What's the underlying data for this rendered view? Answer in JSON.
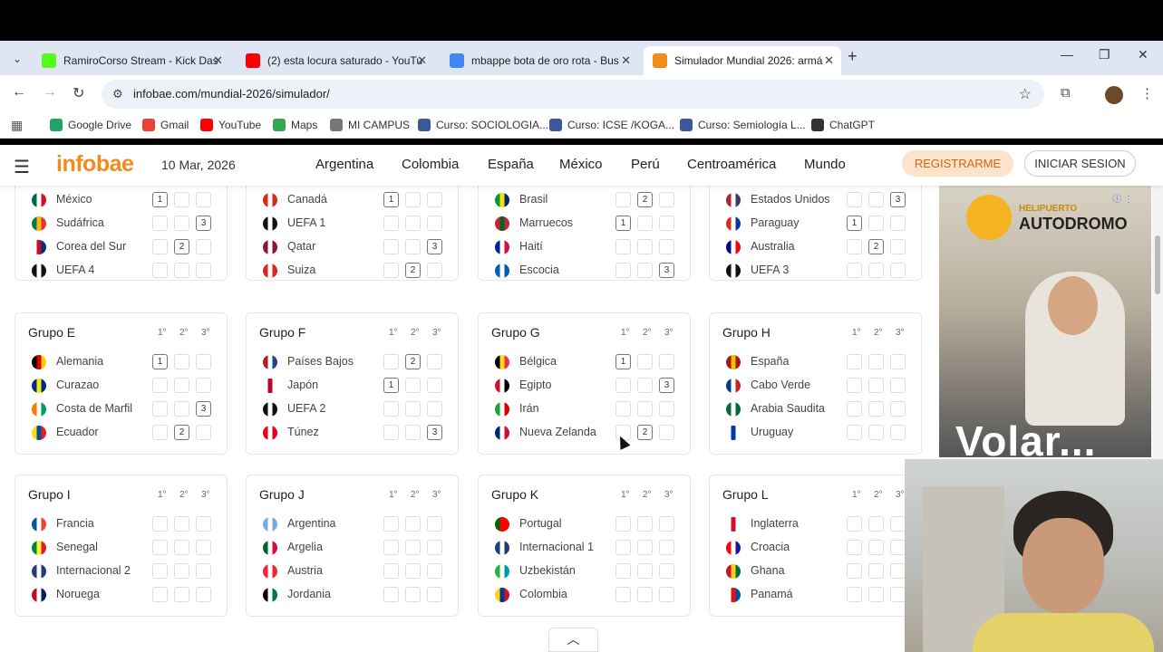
{
  "browser": {
    "tabs": [
      {
        "title": "RamiroCorso Stream - Kick Das",
        "icon": "kick-icon",
        "color": "#53fc18"
      },
      {
        "title": "(2) esta locura saturado - YouTu",
        "icon": "youtube-icon",
        "color": "#ff0000"
      },
      {
        "title": "mbappe bota de oro rota - Bus",
        "icon": "google-icon",
        "color": "#4285f4"
      },
      {
        "title": "Simulador Mundial 2026: armá",
        "icon": "infobae-icon",
        "color": "#f18b1c"
      }
    ],
    "url": "infobae.com/mundial-2026/simulador/",
    "bookmarks": [
      {
        "label": "Google Drive",
        "color": "#1fa463"
      },
      {
        "label": "Gmail",
        "color": "#ea4335"
      },
      {
        "label": "YouTube",
        "color": "#ff0000"
      },
      {
        "label": "Maps",
        "color": "#34a853"
      },
      {
        "label": "MI CAMPUS",
        "color": "#777777"
      },
      {
        "label": "Curso: SOCIOLOGIA...",
        "color": "#3b5998"
      },
      {
        "label": "Curso: ICSE /KOGA...",
        "color": "#3b5998"
      },
      {
        "label": "Curso: Semiología L...",
        "color": "#3b5998"
      },
      {
        "label": "ChatGPT",
        "color": "#333333"
      }
    ]
  },
  "site": {
    "logo": "infobae",
    "date": "10 Mar, 2026",
    "nav": [
      "Argentina",
      "Colombia",
      "España",
      "México",
      "Perú",
      "Centroamérica",
      "Mundo"
    ],
    "register_label": "REGISTRARME",
    "login_label": "INICIAR SESION"
  },
  "pos_headers": [
    "1°",
    "2°",
    "3°"
  ],
  "groups": [
    {
      "title": "",
      "teams": [
        {
          "name": "México",
          "pick": 1,
          "flag": [
            "#006847",
            "#ffffff",
            "#ce1126"
          ]
        },
        {
          "name": "Sudáfrica",
          "pick": 3,
          "flag": [
            "#007a4d",
            "#ffb612",
            "#de3831"
          ]
        },
        {
          "name": "Corea del Sur",
          "pick": 2,
          "flag": [
            "#ffffff",
            "#c60c30",
            "#003478"
          ]
        },
        {
          "name": "UEFA 4",
          "pick": 0,
          "flag": [
            "#111111",
            "#ffffff",
            "#111111"
          ]
        }
      ]
    },
    {
      "title": "",
      "teams": [
        {
          "name": "Canadá",
          "pick": 1,
          "flag": [
            "#d52b1e",
            "#ffffff",
            "#d52b1e"
          ]
        },
        {
          "name": "UEFA 1",
          "pick": 0,
          "flag": [
            "#111111",
            "#ffffff",
            "#111111"
          ]
        },
        {
          "name": "Qatar",
          "pick": 3,
          "flag": [
            "#8a1538",
            "#ffffff",
            "#8a1538"
          ]
        },
        {
          "name": "Suiza",
          "pick": 2,
          "flag": [
            "#da291c",
            "#ffffff",
            "#da291c"
          ]
        }
      ]
    },
    {
      "title": "",
      "teams": [
        {
          "name": "Brasil",
          "pick": 2,
          "flag": [
            "#009c3b",
            "#ffdf00",
            "#002776"
          ]
        },
        {
          "name": "Marruecos",
          "pick": 1,
          "flag": [
            "#c1272d",
            "#006233",
            "#c1272d"
          ]
        },
        {
          "name": "Haití",
          "pick": 0,
          "flag": [
            "#00209f",
            "#ffffff",
            "#d21034"
          ]
        },
        {
          "name": "Escocia",
          "pick": 3,
          "flag": [
            "#005eb8",
            "#ffffff",
            "#005eb8"
          ]
        }
      ]
    },
    {
      "title": "",
      "teams": [
        {
          "name": "Estados Unidos",
          "pick": 3,
          "flag": [
            "#b22234",
            "#ffffff",
            "#3c3b6e"
          ]
        },
        {
          "name": "Paraguay",
          "pick": 1,
          "flag": [
            "#d52b1e",
            "#ffffff",
            "#0038a8"
          ]
        },
        {
          "name": "Australia",
          "pick": 2,
          "flag": [
            "#00008b",
            "#ffffff",
            "#ff0000"
          ]
        },
        {
          "name": "UEFA 3",
          "pick": 0,
          "flag": [
            "#111111",
            "#ffffff",
            "#111111"
          ]
        }
      ]
    },
    {
      "title": "Grupo E",
      "teams": [
        {
          "name": "Alemania",
          "pick": 1,
          "flag": [
            "#000000",
            "#dd0000",
            "#ffce00"
          ]
        },
        {
          "name": "Curazao",
          "pick": 0,
          "flag": [
            "#002b7f",
            "#f9e814",
            "#002b7f"
          ]
        },
        {
          "name": "Costa de Marfil",
          "pick": 3,
          "flag": [
            "#f77f00",
            "#ffffff",
            "#009e60"
          ]
        },
        {
          "name": "Ecuador",
          "pick": 2,
          "flag": [
            "#ffdd00",
            "#034ea2",
            "#ed1c24"
          ]
        }
      ]
    },
    {
      "title": "Grupo F",
      "teams": [
        {
          "name": "Países Bajos",
          "pick": 2,
          "flag": [
            "#ae1c28",
            "#ffffff",
            "#21468b"
          ]
        },
        {
          "name": "Japón",
          "pick": 1,
          "flag": [
            "#ffffff",
            "#bc002d",
            "#ffffff"
          ]
        },
        {
          "name": "UEFA 2",
          "pick": 0,
          "flag": [
            "#111111",
            "#ffffff",
            "#111111"
          ]
        },
        {
          "name": "Túnez",
          "pick": 3,
          "flag": [
            "#e70013",
            "#ffffff",
            "#e70013"
          ]
        }
      ]
    },
    {
      "title": "Grupo G",
      "teams": [
        {
          "name": "Bélgica",
          "pick": 1,
          "flag": [
            "#000000",
            "#fdda24",
            "#ef3340"
          ]
        },
        {
          "name": "Egipto",
          "pick": 3,
          "flag": [
            "#ce1126",
            "#ffffff",
            "#000000"
          ]
        },
        {
          "name": "Irán",
          "pick": 0,
          "flag": [
            "#239f40",
            "#ffffff",
            "#da0000"
          ]
        },
        {
          "name": "Nueva Zelanda",
          "pick": 2,
          "flag": [
            "#00247d",
            "#ffffff",
            "#cc142b"
          ]
        }
      ]
    },
    {
      "title": "Grupo H",
      "teams": [
        {
          "name": "España",
          "pick": 0,
          "flag": [
            "#aa151b",
            "#f1bf00",
            "#aa151b"
          ]
        },
        {
          "name": "Cabo Verde",
          "pick": 0,
          "flag": [
            "#003893",
            "#ffffff",
            "#cf2027"
          ]
        },
        {
          "name": "Arabia Saudita",
          "pick": 0,
          "flag": [
            "#006c35",
            "#ffffff",
            "#006c35"
          ]
        },
        {
          "name": "Uruguay",
          "pick": 0,
          "flag": [
            "#ffffff",
            "#0038a8",
            "#ffffff"
          ]
        }
      ]
    },
    {
      "title": "Grupo I",
      "teams": [
        {
          "name": "Francia",
          "pick": 0,
          "flag": [
            "#0055a4",
            "#ffffff",
            "#ef4135"
          ]
        },
        {
          "name": "Senegal",
          "pick": 0,
          "flag": [
            "#00853f",
            "#fdef42",
            "#e31b23"
          ]
        },
        {
          "name": "Internacional 2",
          "pick": 0,
          "flag": [
            "#1f3d7a",
            "#ffffff",
            "#1f3d7a"
          ]
        },
        {
          "name": "Noruega",
          "pick": 0,
          "flag": [
            "#ba0c2f",
            "#ffffff",
            "#00205b"
          ]
        }
      ]
    },
    {
      "title": "Grupo J",
      "teams": [
        {
          "name": "Argentina",
          "pick": 0,
          "flag": [
            "#74acdf",
            "#ffffff",
            "#74acdf"
          ]
        },
        {
          "name": "Argelia",
          "pick": 0,
          "flag": [
            "#006233",
            "#ffffff",
            "#d21034"
          ]
        },
        {
          "name": "Austria",
          "pick": 0,
          "flag": [
            "#ed2939",
            "#ffffff",
            "#ed2939"
          ]
        },
        {
          "name": "Jordania",
          "pick": 0,
          "flag": [
            "#000000",
            "#ffffff",
            "#007a3d"
          ]
        }
      ]
    },
    {
      "title": "Grupo K",
      "teams": [
        {
          "name": "Portugal",
          "pick": 0,
          "flag": [
            "#006600",
            "#ff0000",
            "#ff0000"
          ]
        },
        {
          "name": "Internacional 1",
          "pick": 0,
          "flag": [
            "#1f3d7a",
            "#ffffff",
            "#1f3d7a"
          ]
        },
        {
          "name": "Uzbekistán",
          "pick": 0,
          "flag": [
            "#1eb53a",
            "#ffffff",
            "#0099b5"
          ]
        },
        {
          "name": "Colombia",
          "pick": 0,
          "flag": [
            "#fcd116",
            "#003893",
            "#ce1126"
          ]
        }
      ]
    },
    {
      "title": "Grupo L",
      "teams": [
        {
          "name": "Inglaterra",
          "pick": 0,
          "flag": [
            "#ffffff",
            "#ce1124",
            "#ffffff"
          ]
        },
        {
          "name": "Croacia",
          "pick": 0,
          "flag": [
            "#ff0000",
            "#ffffff",
            "#171796"
          ]
        },
        {
          "name": "Ghana",
          "pick": 0,
          "flag": [
            "#ce1126",
            "#fcd116",
            "#006b3f"
          ]
        },
        {
          "name": "Panamá",
          "pick": 0,
          "flag": [
            "#ffffff",
            "#da121a",
            "#005293"
          ]
        }
      ]
    }
  ],
  "ad": {
    "line1": "HELIPUERTO",
    "line2": "AUTODROMO",
    "headline": "Volar..."
  }
}
